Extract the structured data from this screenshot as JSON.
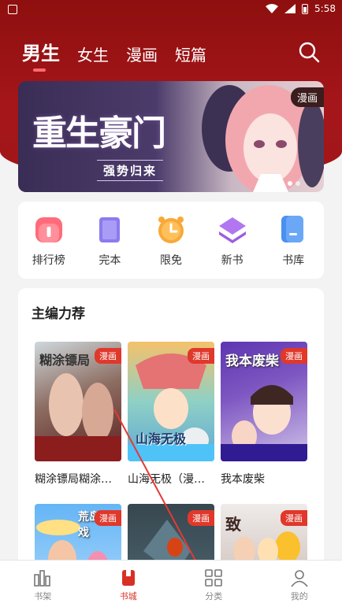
{
  "status": {
    "time": "5:58"
  },
  "tabs": [
    {
      "label": "男生",
      "active": true
    },
    {
      "label": "女生",
      "active": false
    },
    {
      "label": "漫画",
      "active": false
    },
    {
      "label": "短篇",
      "active": false
    }
  ],
  "banner": {
    "title": "重生豪门",
    "subtitle": "强势归来",
    "badge": "漫画"
  },
  "quick": [
    {
      "label": "排行榜",
      "icon": "ranking-icon"
    },
    {
      "label": "完本",
      "icon": "finished-book-icon"
    },
    {
      "label": "限免",
      "icon": "clock-icon"
    },
    {
      "label": "新书",
      "icon": "layers-icon"
    },
    {
      "label": "书库",
      "icon": "library-icon"
    }
  ],
  "recommend": {
    "title": "主编力荐",
    "badge": "漫画",
    "books": [
      {
        "name": "糊涂镖局糊涂…",
        "cover_text": "糊涂镖局"
      },
      {
        "name": "山海无极（漫…",
        "cover_text": "山海无极"
      },
      {
        "name": "我本废柴",
        "cover_text": "我本废柴"
      },
      {
        "name": "",
        "cover_text": "荒岛游戏"
      },
      {
        "name": "",
        "cover_text": ""
      },
      {
        "name": "",
        "cover_text": "致"
      }
    ]
  },
  "nav": [
    {
      "label": "书架",
      "icon": "bookshelf-icon",
      "active": false
    },
    {
      "label": "书城",
      "icon": "bookstore-icon",
      "active": true
    },
    {
      "label": "分类",
      "icon": "category-icon",
      "active": false
    },
    {
      "label": "我的",
      "icon": "profile-icon",
      "active": false
    }
  ],
  "colors": {
    "header": "#a5161a",
    "accent": "#d93025"
  }
}
